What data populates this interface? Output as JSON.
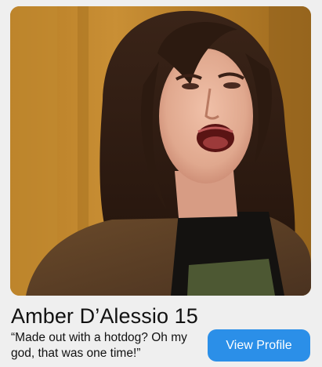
{
  "profile": {
    "name": "Amber D’Alessio 15",
    "quote": "“Made out with a hotdog? Oh my god, that was one time!”",
    "photo_alt": "profile photo",
    "view_button_label": "View Profile"
  },
  "colors": {
    "background": "#efefef",
    "button": "#2b8fe8",
    "button_text": "#ffffff",
    "text": "#111111"
  }
}
